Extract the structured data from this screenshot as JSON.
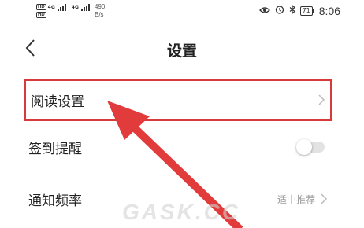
{
  "status_bar": {
    "net_speed_value": "490",
    "net_speed_unit": "B/s",
    "signal_tag": "4G",
    "battery": "71",
    "time": "8:06",
    "icons": [
      "eye-icon",
      "alarm-icon",
      "bluetooth-icon"
    ]
  },
  "header": {
    "title": "设置",
    "back_icon": "chevron-left-icon"
  },
  "settings": {
    "items": [
      {
        "label": "阅读设置",
        "control": "chevron",
        "highlighted": true
      },
      {
        "label": "签到提醒",
        "control": "toggle",
        "toggle_on": false
      },
      {
        "label": "通知频率",
        "control": "chevron",
        "value": "适中推荐"
      }
    ]
  },
  "annotation": {
    "highlight_color": "#d63a3a",
    "arrow_color": "#e23b3b"
  },
  "watermark": "GASK.CC"
}
